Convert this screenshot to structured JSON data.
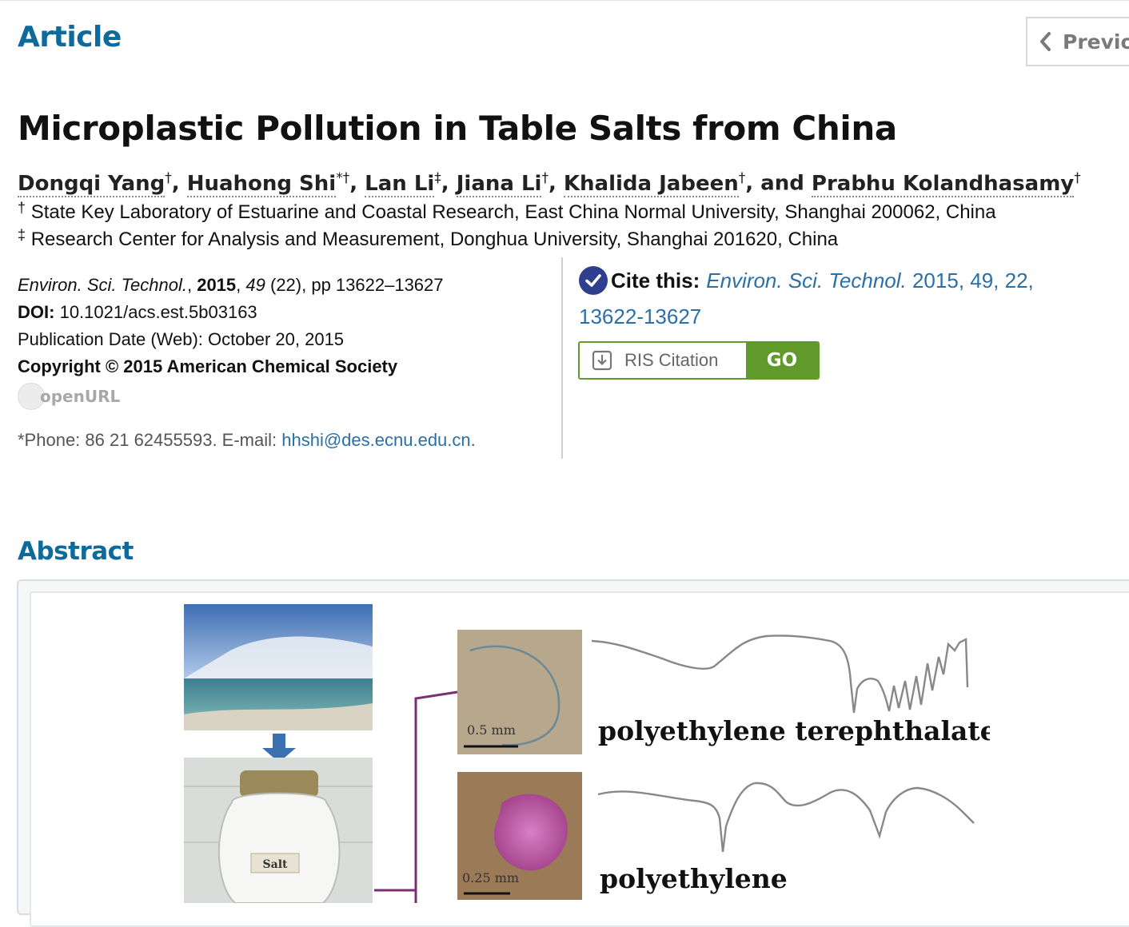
{
  "header": {
    "article_heading": "Article",
    "prev_label": "Previou"
  },
  "article": {
    "title": "Microplastic Pollution in Table Salts from China",
    "authors": [
      {
        "name": "Dongqi Yang",
        "mark": "†"
      },
      {
        "name": "Huahong Shi",
        "mark": "*†"
      },
      {
        "name": "Lan Li",
        "mark": "‡"
      },
      {
        "name": "Jiana Li",
        "mark": "†"
      },
      {
        "name": "Khalida Jabeen",
        "mark": "†"
      },
      {
        "name": "Prabhu Kolandhasamy",
        "mark": "†"
      }
    ],
    "authors_and": ", and ",
    "authors_sep": ", ",
    "affiliations": [
      {
        "mark": "†",
        "text": "State Key Laboratory of Estuarine and Coastal Research, East China Normal University, Shanghai 200062, China"
      },
      {
        "mark": "‡",
        "text": "Research Center for Analysis and Measurement, Donghua University, Shanghai 201620, China"
      }
    ]
  },
  "meta": {
    "journal": "Environ. Sci. Technol.",
    "year": "2015",
    "volume": "49",
    "issue_pages": " (22), pp 13622–13627",
    "doi_label": "DOI:",
    "doi": "10.1021/acs.est.5b03163",
    "pub_date": "Publication Date (Web): October 20, 2015",
    "copyright": "Copyright © 2015 American Chemical Society",
    "openurl": "openURL",
    "contact_prefix": "*Phone: 86 21 62455593. E-mail: ",
    "contact_email": "hhshi@des.ecnu.edu.cn",
    "contact_suffix": "."
  },
  "cite": {
    "label": "Cite this:",
    "journal": "Environ. Sci. Technol.",
    "rest": " 2015, 49, 22,",
    "pages": "13622-13627",
    "format_option": "RIS Citation",
    "go_label": "GO"
  },
  "abstract": {
    "heading": "Abstract",
    "graphic": {
      "label_pet": "polyethylene terephthalate",
      "label_pe": "polyethylene",
      "scale_1": "0.5 mm",
      "scale_2": "0.25 mm",
      "jar_label": "Salt"
    }
  },
  "colors": {
    "accent_blue": "#0d6a9b",
    "link_blue": "#2a6fa8",
    "go_green": "#5f9a2b",
    "badge_navy": "#2f3e8e"
  }
}
